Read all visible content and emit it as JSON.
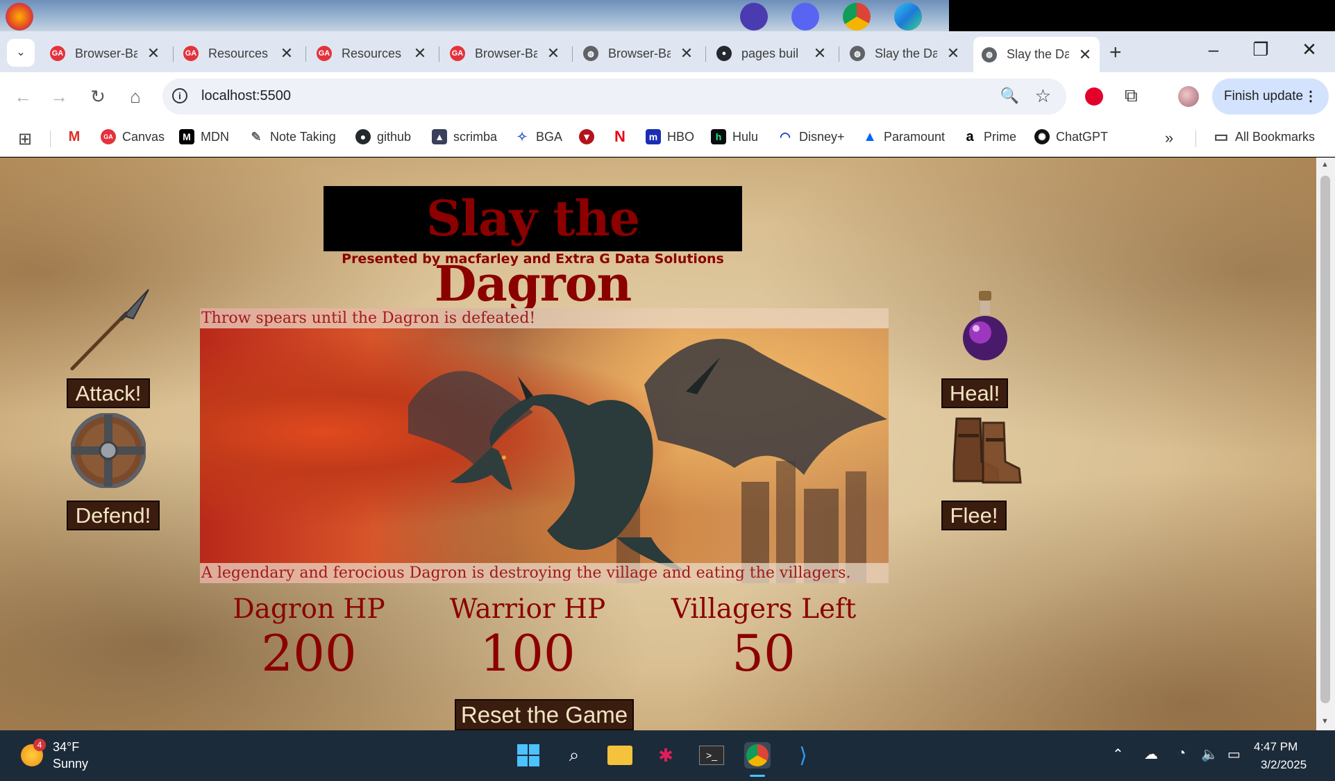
{
  "browser": {
    "tabs": [
      {
        "title": "Browser-Ba",
        "icon": "ga-icon"
      },
      {
        "title": "Resources",
        "icon": "ga-icon"
      },
      {
        "title": "Resources",
        "icon": "ga-icon"
      },
      {
        "title": "Browser-Ba",
        "icon": "ga-icon"
      },
      {
        "title": "Browser-Ba",
        "icon": "globe-icon"
      },
      {
        "title": "pages buil",
        "icon": "github-icon"
      },
      {
        "title": "Slay the Da",
        "icon": "globe-icon"
      },
      {
        "title": "Slay the Da",
        "icon": "globe-icon",
        "active": true
      }
    ],
    "url": "localhost:5500",
    "finish_update": "Finish update",
    "bookmarks": [
      {
        "label": "",
        "icon": "gmail-icon"
      },
      {
        "label": "Canvas",
        "icon": "ga-icon"
      },
      {
        "label": "MDN",
        "icon": "mdn-icon"
      },
      {
        "label": "Note Taking",
        "icon": "pencil-icon"
      },
      {
        "label": "github",
        "icon": "github-icon"
      },
      {
        "label": "scrimba",
        "icon": "scrimba-icon"
      },
      {
        "label": "BGA",
        "icon": "bga-icon"
      },
      {
        "label": "",
        "icon": "devil-icon"
      },
      {
        "label": "",
        "icon": "netflix-icon"
      },
      {
        "label": "HBO",
        "icon": "hbo-icon"
      },
      {
        "label": "Hulu",
        "icon": "hulu-icon"
      },
      {
        "label": "Disney+",
        "icon": "disney-icon"
      },
      {
        "label": "Paramount",
        "icon": "paramount-icon"
      },
      {
        "label": "Prime",
        "icon": "amazon-icon"
      },
      {
        "label": "ChatGPT",
        "icon": "chatgpt-icon"
      }
    ],
    "all_bookmarks": "All Bookmarks"
  },
  "game": {
    "title": "Slay the Dagron",
    "subtitle": "Presented by macfarley and Extra G Data Solutions",
    "caption_top": "Throw spears until the Dagron is defeated!",
    "caption_bottom": "A legendary and ferocious Dagron is destroying the village and eating the villagers.",
    "actions": {
      "attack": "Attack!",
      "defend": "Defend!",
      "heal": "Heal!",
      "flee": "Flee!"
    },
    "stats": [
      {
        "label": "Dagron HP",
        "value": "200"
      },
      {
        "label": "Warrior HP",
        "value": "100"
      },
      {
        "label": "Villagers Left",
        "value": "50"
      }
    ],
    "reset": "Reset the Game",
    "colors": {
      "title_red": "#8b0000",
      "button_bg": "#3b1d10",
      "button_text": "#f3e4c4"
    }
  },
  "taskbar": {
    "weather_badge": "4",
    "temperature": "34°F",
    "condition": "Sunny",
    "time": "4:47 PM",
    "date": "3/2/2025"
  }
}
